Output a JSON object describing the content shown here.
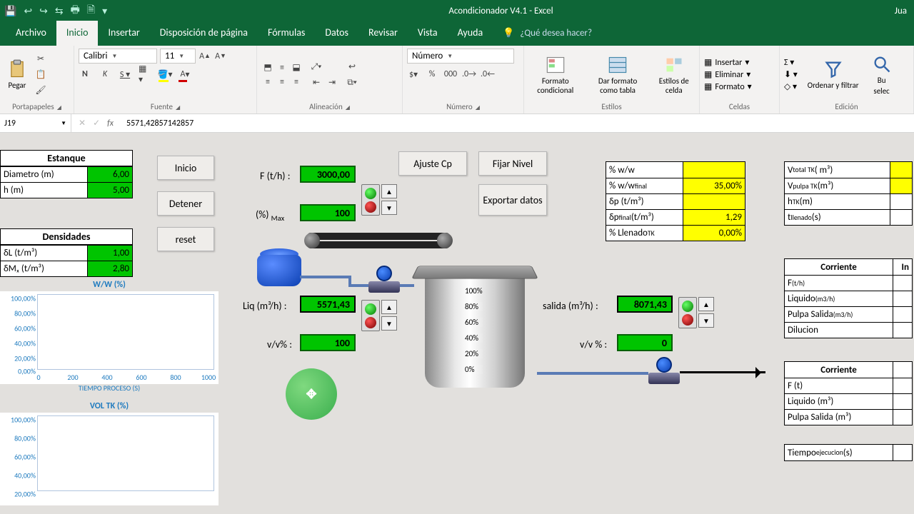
{
  "titlebar": {
    "title": "Acondicionador V4.1 - Excel",
    "user": "Jua"
  },
  "tabs": {
    "archivo": "Archivo",
    "inicio": "Inicio",
    "insertar": "Insertar",
    "disp": "Disposición de página",
    "formulas": "Fórmulas",
    "datos": "Datos",
    "revisar": "Revisar",
    "vista": "Vista",
    "ayuda": "Ayuda",
    "tellme": "¿Qué desea hacer?"
  },
  "ribbon": {
    "paste": "Pegar",
    "portapapeles": "Portapapeles",
    "font": "Calibri",
    "size": "11",
    "fuente": "Fuente",
    "alineacion": "Alineación",
    "numfmt": "Número",
    "numero": "Número",
    "fc": "Formato condicional",
    "ft": "Dar formato como tabla",
    "ec": "Estilos de celda",
    "estilos": "Estilos",
    "insertar": "Insertar",
    "eliminar": "Eliminar",
    "formato": "Formato",
    "celdas": "Celdas",
    "ordenar": "Ordenar y filtrar",
    "bu": "Bu",
    "selec": "selec",
    "edicion": "Edición"
  },
  "namebox": {
    "cell": "J19",
    "formula": "5571,42857142857"
  },
  "estanque": {
    "head": "Estanque",
    "diam_l": "Diametro (m)",
    "diam_v": "6,00",
    "h_l": "h (m)",
    "h_v": "5,00"
  },
  "dens": {
    "head": "Densidades",
    "l1": "δL (t/m³)",
    "v1": "1,00",
    "l2": "δMₓ (t/m³)",
    "v2": "2,80"
  },
  "btns": {
    "inicio": "Inicio",
    "detener": "Detener",
    "reset": "reset",
    "ajuste": "Ajuste Cp",
    "fijar": "Fijar Nivel",
    "exportar": "Exportar datos"
  },
  "inputs": {
    "f_l": "F (t/h) :",
    "f_v": "3000,00",
    "pct_l": "(%) Max",
    "pct_v": "100",
    "liq_l": "Liq (m³/h) :",
    "liq_v": "5571,43",
    "vv_l": "v/v% :",
    "vv_v": "100",
    "sal_l": "salida (m³/h) :",
    "sal_v": "8071,43",
    "vv2_l": "v/v % :",
    "vv2_v": "0"
  },
  "yellow": {
    "r1": "% w/w",
    "v1": "",
    "r2": "% w/w final",
    "v2": "35,00%",
    "r3": "δp (t/m³)",
    "v3": "",
    "r4": "δp final (t/m³)",
    "v4": "1,29",
    "r5": "% Llenado TK",
    "v5": "0,00%"
  },
  "rt1": {
    "r1": "Vtotal TK( m³)",
    "r2": "V pulpa TK(m³)",
    "r3": "hTK(m)",
    "r4": "t llenado (s)"
  },
  "rt2": {
    "head": "Corriente",
    "c2": "In",
    "r1": "F (t/h)",
    "r2": "Liquido (m3/h)",
    "r3": "Pulpa Salida (m3/h)",
    "r4": "Dilucion"
  },
  "rt3": {
    "head": "Corriente",
    "r1": "F (t)",
    "r2": "Liquido (m³)",
    "r3": "Pulpa Salida (m³)"
  },
  "rt4": {
    "r1": "Tiempo ejecucion (s)"
  },
  "chart1": {
    "title": "W/W (%)",
    "xlab": "TIEMPO PROCESO (S)"
  },
  "chart2": {
    "title": "VOL TK (%)"
  },
  "chart_data": {
    "ww": {
      "type": "line",
      "title": "W/W (%)",
      "xlabel": "TIEMPO PROCESO (S)",
      "x": [
        0,
        200,
        400,
        600,
        800,
        1000
      ],
      "y": [],
      "ylim": [
        0,
        100
      ],
      "yticks": [
        0,
        20,
        40,
        60,
        80,
        100
      ]
    },
    "vol": {
      "type": "line",
      "title": "VOL TK (%)",
      "x": [],
      "y": [],
      "ylim": [
        0,
        100
      ],
      "yticks": [
        20,
        40,
        60,
        80,
        100
      ]
    }
  },
  "tank_scale": [
    "100%",
    "80%",
    "60%",
    "40%",
    "20%",
    "0%"
  ]
}
